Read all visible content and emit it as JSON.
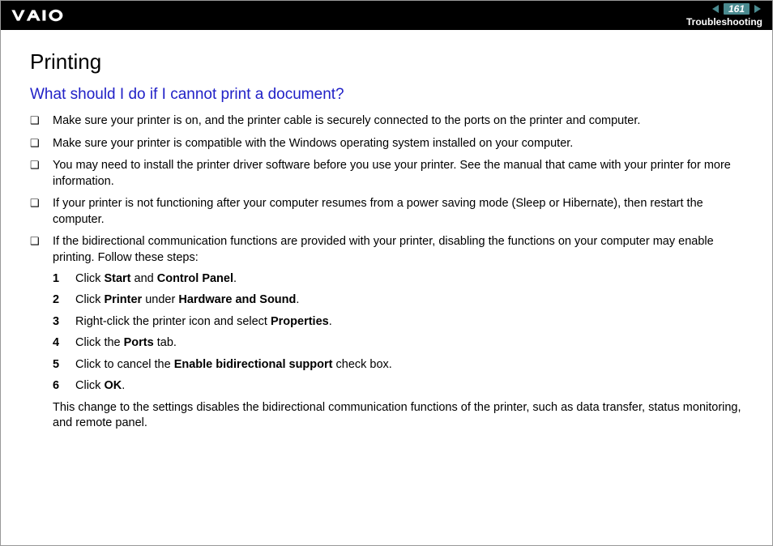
{
  "header": {
    "page_number": "161",
    "section": "Troubleshooting"
  },
  "content": {
    "title": "Printing",
    "subtitle": "What should I do if I cannot print a document?",
    "bullets": [
      {
        "text": "Make sure your printer is on, and the printer cable is securely connected to the ports on the printer and computer."
      },
      {
        "text": "Make sure your printer is compatible with the Windows operating system installed on your computer."
      },
      {
        "text": "You may need to install the printer driver software before you use your printer. See the manual that came with your printer for more information."
      },
      {
        "text": "If your printer is not functioning after your computer resumes from a power saving mode (Sleep or Hibernate), then restart the computer."
      },
      {
        "text": "If the bidirectional communication functions are provided with your printer, disabling the functions on your computer may enable printing. Follow these steps:"
      }
    ],
    "steps": [
      {
        "num": "1",
        "pre": "Click ",
        "b1": "Start",
        "mid": " and ",
        "b2": "Control Panel",
        "post": "."
      },
      {
        "num": "2",
        "pre": "Click ",
        "b1": "Printer",
        "mid": " under ",
        "b2": "Hardware and Sound",
        "post": "."
      },
      {
        "num": "3",
        "pre": "Right-click the printer icon and select ",
        "b1": "Properties",
        "mid": "",
        "b2": "",
        "post": "."
      },
      {
        "num": "4",
        "pre": "Click the ",
        "b1": "Ports",
        "mid": "",
        "b2": "",
        "post": " tab."
      },
      {
        "num": "5",
        "pre": "Click to cancel the ",
        "b1": "Enable bidirectional support",
        "mid": "",
        "b2": "",
        "post": " check box."
      },
      {
        "num": "6",
        "pre": "Click ",
        "b1": "OK",
        "mid": "",
        "b2": "",
        "post": "."
      }
    ],
    "follow": "This change to the settings disables the bidirectional communication functions of the printer, such as data transfer, status monitoring, and remote panel."
  }
}
